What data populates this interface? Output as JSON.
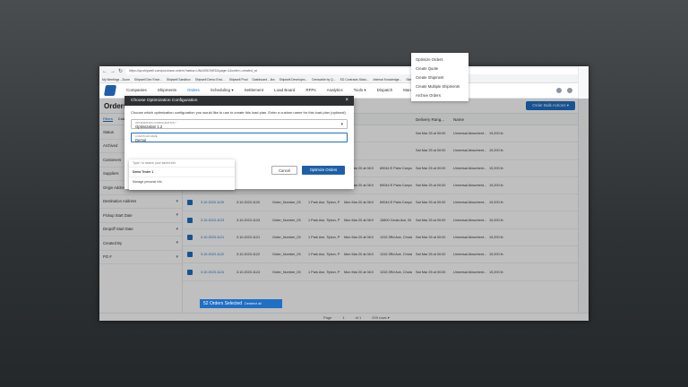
{
  "browser": {
    "url": "https://qa.shipwell.com/purchase-orders?status=UNASSIGNED&page=1&order=-created_at",
    "bookmarks": [
      "My Meetings - Zoom",
      "Shipwell Dev Envir...",
      "Shipwell Sandbox",
      "Shipwell Demo Envi...",
      "Shipwell Prod",
      "Dashboard - Jira",
      "Shipwell Developm...",
      "Demoable by Q...",
      "ED Contracts Statu...",
      "Internal Knowledge...",
      "Site administration...",
      "BenefitFocus - Sign..."
    ]
  },
  "nav": {
    "items": [
      "Companies",
      "Shipments",
      "Orders",
      "Scheduling ▾",
      "Settlement",
      "Load Board",
      "RFPs",
      "Analytics",
      "Tools ▾",
      "Dispatch",
      "Manage ▾"
    ],
    "active_index": 2
  },
  "page": {
    "title": "Orders",
    "search_placeholder": "Search orders",
    "bulk_button": "Order Bulk Actions  ▾"
  },
  "bulk_menu": [
    "Optimize Orders",
    "Create Quote",
    "Create Shipment",
    "Create Multiple Shipments",
    "Archive Orders"
  ],
  "filters": {
    "tabs": [
      "Filters",
      "Columns",
      "Saved"
    ],
    "items": [
      "Status",
      "Archived",
      "Customers",
      "Suppliers",
      "Origin Address",
      "Destination Address",
      "Pickup Start Date",
      "Dropoff Start Date",
      "Created By",
      "PO #"
    ],
    "status_value": "UnA"
  },
  "grid": {
    "status_pill": "Status: Unassigned",
    "columns": [
      "Order",
      "",
      "",
      "",
      "",
      "",
      "Delivery Rang...",
      "Name",
      ""
    ],
    "rows": [
      [
        "3.10.2023.1111",
        "",
        "",
        "",
        "",
        "",
        "Sat Mar 25 at 00:00",
        "Universal Absorbent...",
        "19,200 lb"
      ],
      [
        "3.10.2023.1112",
        "",
        "",
        "",
        "",
        "",
        "Sat Mar 25 at 00:00",
        "Universal Absorbent...",
        "19,200 lb"
      ],
      [
        "3.10.2023.1118",
        "3.10.2023.1118",
        "Order_Number_03",
        "1 Park Ave, Tipton, P",
        "Mon Mar 20 at 08:0",
        "69044 E Palm Canyo",
        "Sat Mar 25 at 00:00",
        "Universal Absorbent...",
        "19,200 lb"
      ],
      [
        "3.10.2023.1119",
        "3.10.2023.1119",
        "Order_Number_03",
        "1 Park Ave, Tipton, P",
        "Mon Mar 20 at 08:0",
        "69044 E Palm Canyo",
        "Sat Mar 25 at 00:00",
        "Universal Absorbent...",
        "19,200 lb"
      ],
      [
        "3.10.2023.1120",
        "3.10.2023.1120",
        "Order_Number_03",
        "1 Park Ave, Tipton, P",
        "Mon Mar 20 at 08:0",
        "69044 E Palm Canyo",
        "Sat Mar 25 at 00:00",
        "Universal Absorbent...",
        "19,200 lb"
      ],
      [
        "3.10.2023.1123",
        "3.10.2023.1123",
        "Order_Number_03",
        "1 Park Ave, Tipton, P",
        "Mon Mar 20 at 08:0",
        "15800 Cedar Ave, Bl",
        "Sat Mar 25 at 00:00",
        "Universal Absorbent...",
        "19,200 lb"
      ],
      [
        "3.10.2023.1121",
        "3.10.2023.1121",
        "Order_Number_03",
        "1 Park Ave, Tipton, P",
        "Mon Mar 20 at 08:0",
        "1315 3Rd Ave, Chula",
        "Sat Mar 25 at 00:00",
        "Universal Absorbent...",
        "19,200 lb"
      ],
      [
        "3.10.2023.1122",
        "3.10.2023.1122",
        "Order_Number_03",
        "1 Park Ave, Tipton, P",
        "Mon Mar 20 at 08:0",
        "1315 3Rd Ave, Chula",
        "Sat Mar 25 at 00:00",
        "Universal Absorbent...",
        "19,200 lb"
      ],
      [
        "3.10.2023.1124",
        "3.10.2023.1124",
        "Order_Number_03",
        "1 Park Ave, Tipton, P",
        "Mon Mar 20 at 08:0",
        "1315 3Rd Ave, Chula",
        "Sat Mar 25 at 00:00",
        "Universal Absorbent...",
        "19,200 lb"
      ]
    ]
  },
  "modal": {
    "title": "Choose Optimization Configuration",
    "description": "Choose which optimization configuration you would like to use to create this load plan. Enter a custom name for this load plan (optional).",
    "config_label": "OPTIMIZATION CONFIGURATION *",
    "config_value": "Optimization 1.2",
    "name_label": "LOAD PLAN NAME",
    "name_value": "Demo|",
    "popup_hint": "Type / to search your saved info",
    "popup_option": "Demo Tester 1",
    "popup_manage": "Manage personal info",
    "cancel": "Cancel",
    "submit": "Optimize Orders"
  },
  "footer": {
    "selected": "52 Orders Selected",
    "deselect": "Deselect all",
    "page": "Page",
    "page_num": "1",
    "of": "of 1",
    "rows": "200 rows ▾"
  }
}
